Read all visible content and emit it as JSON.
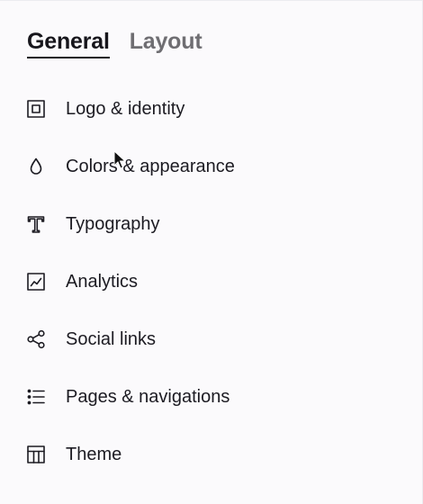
{
  "tabs": [
    {
      "label": "General",
      "active": true
    },
    {
      "label": "Layout",
      "active": false
    }
  ],
  "menu": {
    "items": [
      {
        "label": "Logo & identity",
        "icon": "logo-identity-icon"
      },
      {
        "label": "Colors & appearance",
        "icon": "droplet-icon"
      },
      {
        "label": "Typography",
        "icon": "typography-icon"
      },
      {
        "label": "Analytics",
        "icon": "analytics-chart-icon"
      },
      {
        "label": "Social links",
        "icon": "share-icon"
      },
      {
        "label": "Pages & navigations",
        "icon": "list-icon"
      },
      {
        "label": "Theme",
        "icon": "theme-layout-icon"
      }
    ]
  },
  "colors": {
    "background": "#fbfafc",
    "text": "#1c1b22",
    "inactive_tab": "#6f6e72"
  }
}
